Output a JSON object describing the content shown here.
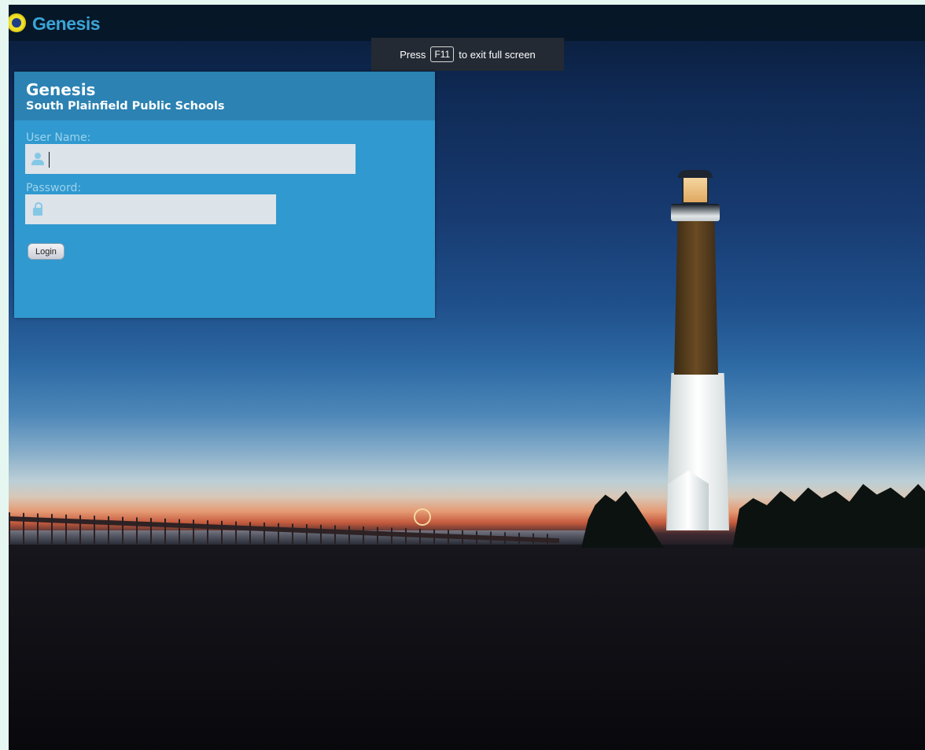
{
  "header": {
    "logo_text": "Genesis"
  },
  "fullscreen_hint": {
    "prefix": "Press",
    "key": "F11",
    "suffix": "to exit full screen"
  },
  "login": {
    "title": "Genesis",
    "subtitle": "South Plainfield Public Schools",
    "username_label": "User Name:",
    "username_value": "",
    "password_label": "Password:",
    "password_value": "",
    "button_label": "Login"
  },
  "icons": {
    "logo": "genesis-logo-icon",
    "user": "user-icon",
    "lock": "lock-icon"
  },
  "colors": {
    "panel": "#3099cf",
    "panel_header": "#2b82b3",
    "logo_text": "#3aa4d6",
    "label": "#9cd3ec"
  }
}
